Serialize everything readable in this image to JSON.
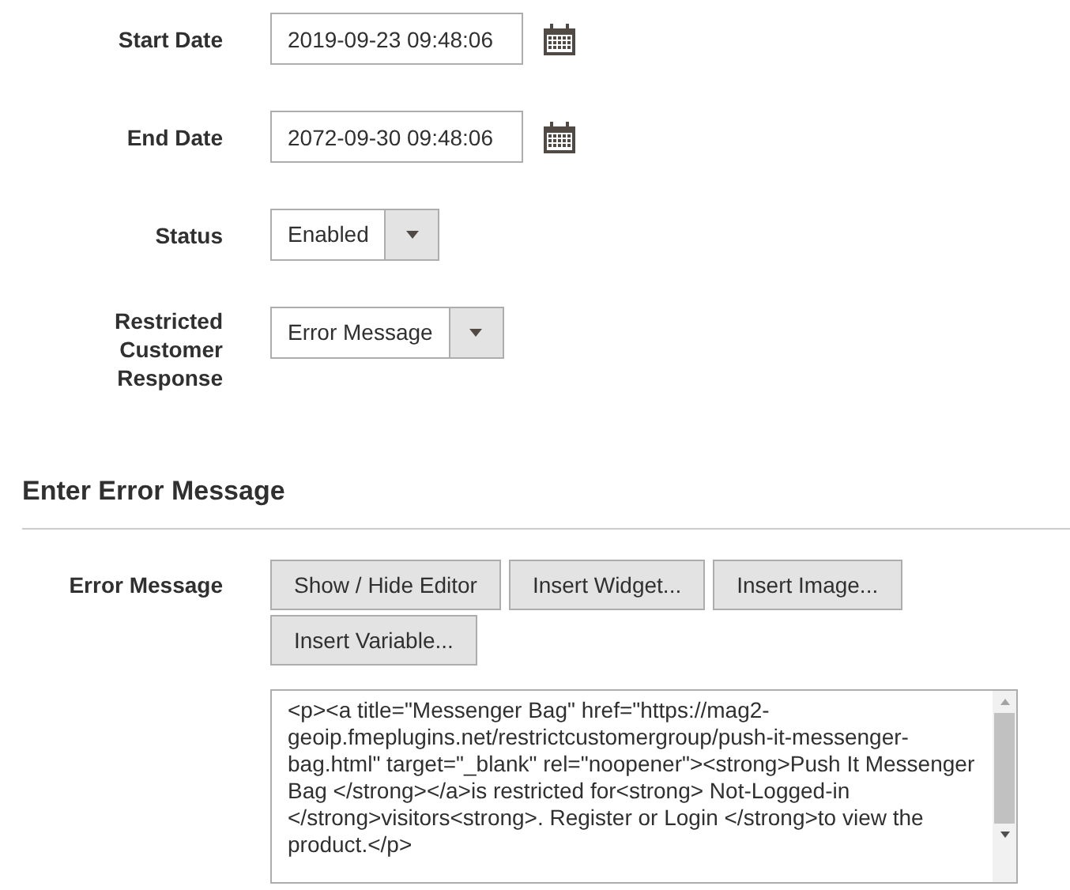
{
  "fields": [
    {
      "kind": "date",
      "label": "Start Date",
      "value": "2019-09-23 09:48:06"
    },
    {
      "kind": "date",
      "label": "End Date",
      "value": "2072-09-30 09:48:06"
    },
    {
      "kind": "select",
      "label": "Status",
      "value": "Enabled"
    },
    {
      "kind": "select",
      "label": "Restricted Customer Response",
      "value": "Error Message"
    }
  ],
  "section": {
    "title": "Enter Error Message",
    "label": "Error Message",
    "buttons": [
      "Show / Hide Editor",
      "Insert Widget...",
      "Insert Image...",
      "Insert Variable..."
    ],
    "editor_value": "<p><a title=\"Messenger Bag\" href=\"https://mag2-geoip.fmeplugins.net/restrictcustomergroup/push-it-messenger-bag.html\" target=\"_blank\" rel=\"noopener\"><strong>Push It Messenger Bag </strong></a>is restricted for<strong> Not-Logged-in </strong>visitors<strong>. Register or Login </strong>to view the product.</p>"
  }
}
